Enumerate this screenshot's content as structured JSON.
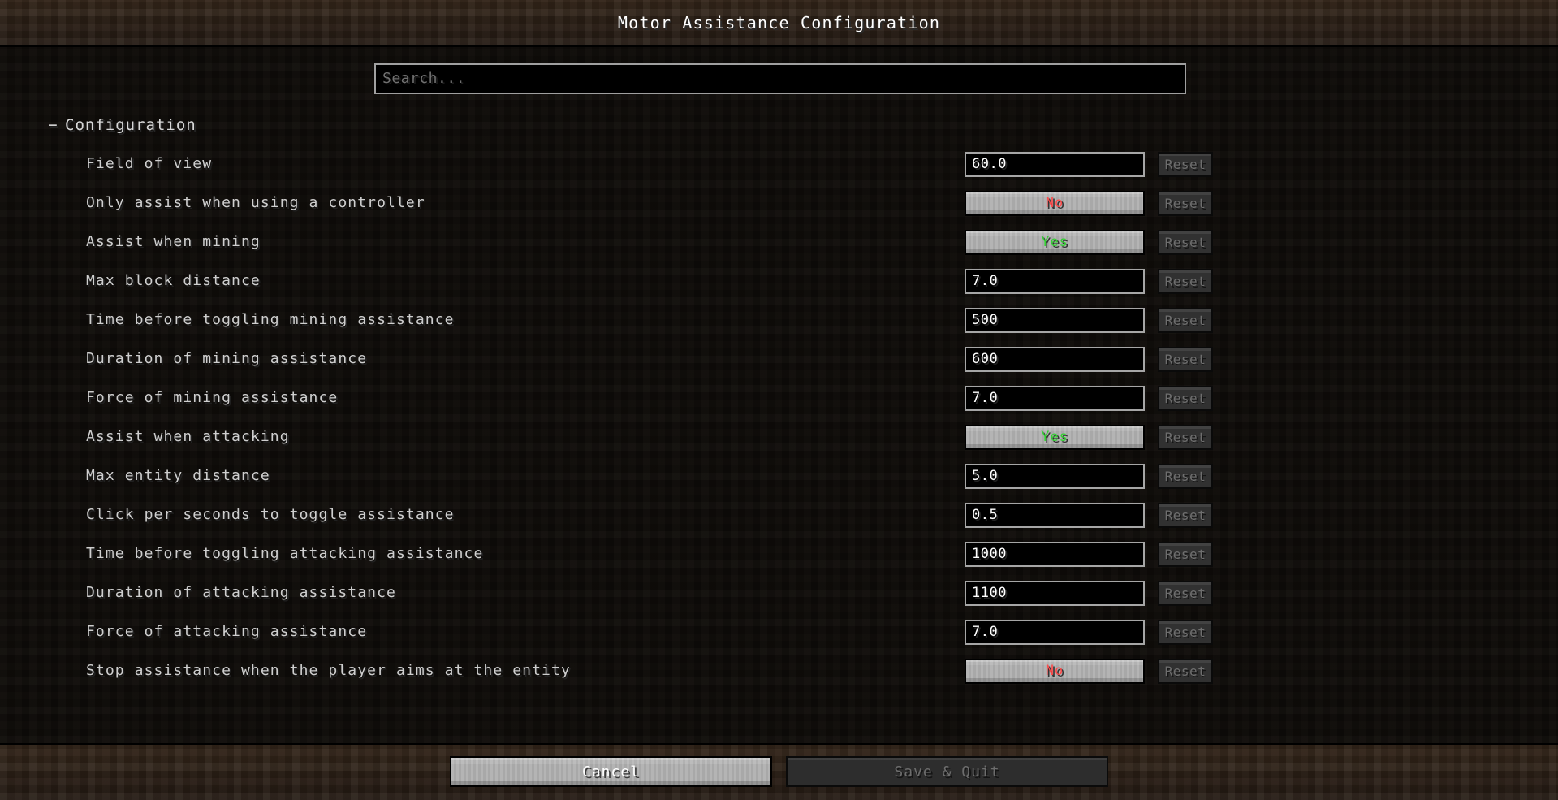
{
  "window": {
    "title": "Motor Assistance Configuration"
  },
  "search": {
    "placeholder": "Search...",
    "value": ""
  },
  "category": {
    "toggle_icon": "minus-icon",
    "toggle_symbol": "−",
    "label": "Configuration",
    "expanded": true
  },
  "colors": {
    "yes": "#33d033",
    "no": "#ff4a4a",
    "text": "#cfcfcf",
    "header_dirt": "#2b2019",
    "body_bg": "#100d0a",
    "button_enabled": "#b0b0b0",
    "button_disabled": "#303030"
  },
  "reset_label": "Reset",
  "settings": [
    {
      "label": "Field of view",
      "type": "text",
      "value": "60.0",
      "reset": "Reset"
    },
    {
      "label": "Only assist when using a controller",
      "type": "bool",
      "value": "No",
      "reset": "Reset"
    },
    {
      "label": "Assist when mining",
      "type": "bool",
      "value": "Yes",
      "reset": "Reset"
    },
    {
      "label": "Max block distance",
      "type": "text",
      "value": "7.0",
      "reset": "Reset"
    },
    {
      "label": "Time before toggling mining assistance",
      "type": "text",
      "value": "500",
      "reset": "Reset"
    },
    {
      "label": "Duration of mining assistance",
      "type": "text",
      "value": "600",
      "reset": "Reset"
    },
    {
      "label": "Force of mining assistance",
      "type": "text",
      "value": "7.0",
      "reset": "Reset"
    },
    {
      "label": "Assist when attacking",
      "type": "bool",
      "value": "Yes",
      "reset": "Reset"
    },
    {
      "label": "Max entity distance",
      "type": "text",
      "value": "5.0",
      "reset": "Reset"
    },
    {
      "label": "Click per seconds to toggle assistance",
      "type": "text",
      "value": "0.5",
      "reset": "Reset"
    },
    {
      "label": "Time before toggling attacking assistance",
      "type": "text",
      "value": "1000",
      "reset": "Reset"
    },
    {
      "label": "Duration of attacking assistance",
      "type": "text",
      "value": "1100",
      "reset": "Reset"
    },
    {
      "label": "Force of attacking assistance",
      "type": "text",
      "value": "7.0",
      "reset": "Reset"
    },
    {
      "label": "Stop assistance when the player aims at the entity",
      "type": "bool",
      "value": "No",
      "reset": "Reset"
    }
  ],
  "footer": {
    "cancel_label": "Cancel",
    "save_quit_label": "Save & Quit"
  }
}
